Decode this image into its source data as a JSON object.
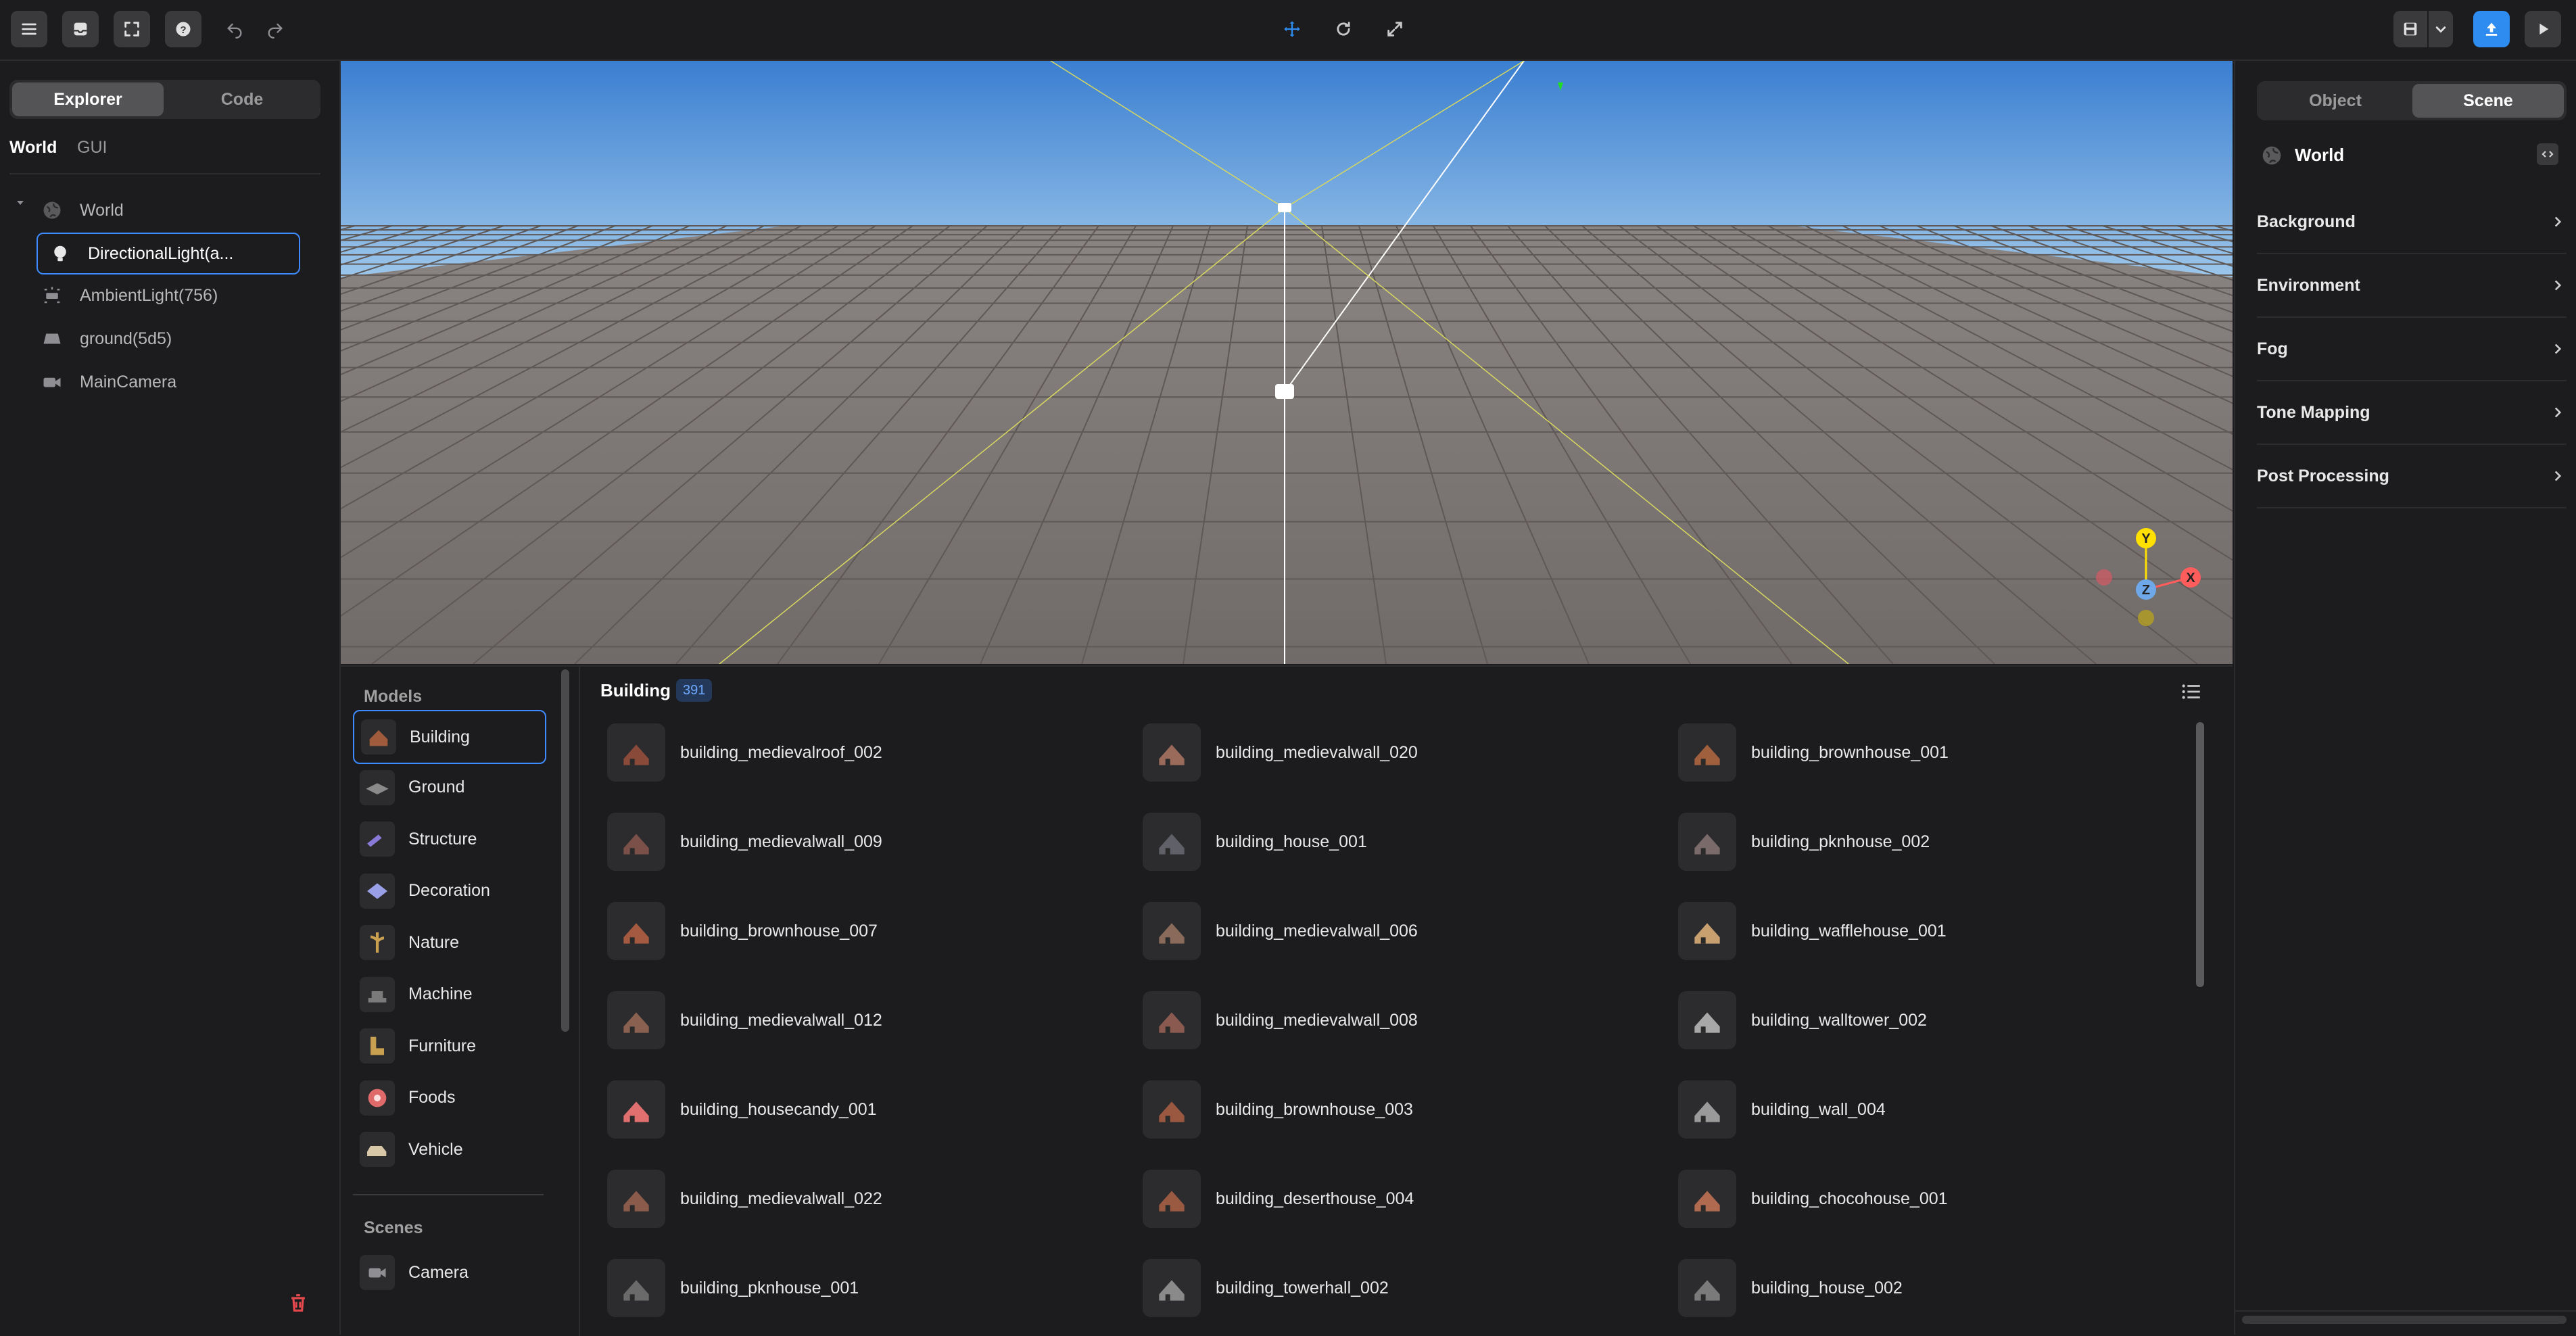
{
  "toolbar": {
    "left_icons": [
      "menu-icon",
      "inbox-icon",
      "fullscreen-icon",
      "help-icon",
      "undo-icon",
      "redo-icon"
    ],
    "center_icons": [
      "move-icon",
      "rotate-icon",
      "scale-icon"
    ],
    "right_icons": [
      "save-icon",
      "chevron-down-icon",
      "publish-icon",
      "play-icon"
    ],
    "accent": "#2e8cf0"
  },
  "left_panel": {
    "tabs": [
      {
        "label": "Explorer",
        "active": true
      },
      {
        "label": "Code",
        "active": false
      }
    ],
    "subtabs": [
      {
        "label": "World",
        "active": true
      },
      {
        "label": "GUI",
        "active": false
      }
    ],
    "tree": [
      {
        "label": "World",
        "icon": "world-icon"
      },
      {
        "label": "DirectionalLight(a...",
        "icon": "light-bulb-icon",
        "selected": true
      },
      {
        "label": "AmbientLight(756)",
        "icon": "ambient-light-icon"
      },
      {
        "label": "ground(5d5)",
        "icon": "ground-icon"
      },
      {
        "label": "MainCamera",
        "icon": "camera-icon"
      }
    ]
  },
  "viewport": {
    "sky_top": "#3b7fd1",
    "sky_bottom": "#9cc6ea",
    "ground": "#7d7775",
    "gizmo": {
      "y": "Y",
      "x": "X",
      "z": "Z"
    }
  },
  "assets": {
    "models_header": "Models",
    "categories": [
      {
        "label": "Building",
        "selected": true
      },
      {
        "label": "Ground"
      },
      {
        "label": "Structure"
      },
      {
        "label": "Decoration"
      },
      {
        "label": "Nature"
      },
      {
        "label": "Machine"
      },
      {
        "label": "Furniture"
      },
      {
        "label": "Foods"
      },
      {
        "label": "Vehicle"
      }
    ],
    "scenes_header": "Scenes",
    "scenes": [
      {
        "label": "Camera"
      }
    ],
    "section_title": "Building",
    "count": "391",
    "items": [
      "building_medievalroof_002",
      "building_medievalwall_020",
      "building_brownhouse_001",
      "building_medievalwall_009",
      "building_house_001",
      "building_pknhouse_002",
      "building_brownhouse_007",
      "building_medievalwall_006",
      "building_wafflehouse_001",
      "building_medievalwall_012",
      "building_medievalwall_008",
      "building_walltower_002",
      "building_housecandy_001",
      "building_brownhouse_003",
      "building_wall_004",
      "building_medievalwall_022",
      "building_deserthouse_004",
      "building_chocohouse_001",
      "building_pknhouse_001",
      "building_towerhall_002",
      "building_house_002"
    ]
  },
  "right_panel": {
    "tabs": [
      {
        "label": "Object",
        "active": false
      },
      {
        "label": "Scene",
        "active": true
      }
    ],
    "world_label": "World",
    "sections": [
      "Background",
      "Environment",
      "Fog",
      "Tone Mapping",
      "Post Processing"
    ]
  }
}
